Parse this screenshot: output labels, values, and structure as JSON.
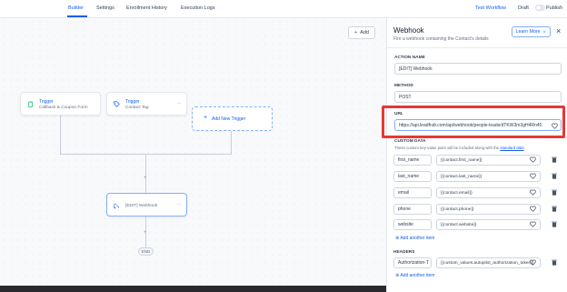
{
  "tabs": [
    {
      "label": "Builder",
      "active": true
    },
    {
      "label": "Settings",
      "active": false
    },
    {
      "label": "Enrollment History",
      "active": false
    },
    {
      "label": "Execution Logs",
      "active": false
    }
  ],
  "top_actions": {
    "test_workflow": "Test Workflow",
    "draft": "Draft",
    "publish": "Publish"
  },
  "canvas": {
    "add_label": "Add",
    "triggers": [
      {
        "title": "Trigger",
        "subtitle": "Callback & Coupon Form",
        "icon": "clipboard-icon"
      },
      {
        "title": "Trigger",
        "subtitle": "Contact Tag",
        "icon": "tag-icon"
      }
    ],
    "add_trigger_label": "Add New Trigger",
    "action_node": {
      "label": "[EDIT] Webhook",
      "icon": "webhook-icon"
    },
    "end_label": "END"
  },
  "panel": {
    "title": "Webhook",
    "subtitle": "Fire a webhook containing the Contact's details",
    "learn_more": "Learn More",
    "action_name_label": "ACTION NAME",
    "action_name_value": "[EDIT] Webhook",
    "method_label": "METHOD",
    "method_value": "POST",
    "url_label": "URL",
    "url_value": "https://api.leadfndr.com/api/webhook/people-leads/dTKW3m3gH4Rn45",
    "custom_data_label": "CUSTOM DATA",
    "custom_data_helper": "These custom key-value pairs will be included along with the",
    "custom_data_helper_link": "standard data",
    "custom_data": [
      {
        "key": "first_name",
        "value": "{{contact.first_name}}"
      },
      {
        "key": "last_name",
        "value": "{{contact.last_name}}"
      },
      {
        "key": "email",
        "value": "{{contact.email}}"
      },
      {
        "key": "phone",
        "value": "{{contact.phone}}"
      },
      {
        "key": "website",
        "value": "{{contact.website}}"
      }
    ],
    "add_another_item": "Add another item",
    "headers_label": "HEADERS",
    "headers": [
      {
        "key": "Authorization-T",
        "value": "{{custom_values.autopilot_authorization_token}}"
      }
    ],
    "add_another_item_2": "Add another item"
  },
  "colors": {
    "accent": "#155eef",
    "highlight": "#e53935",
    "border": "#d0d5dd"
  }
}
